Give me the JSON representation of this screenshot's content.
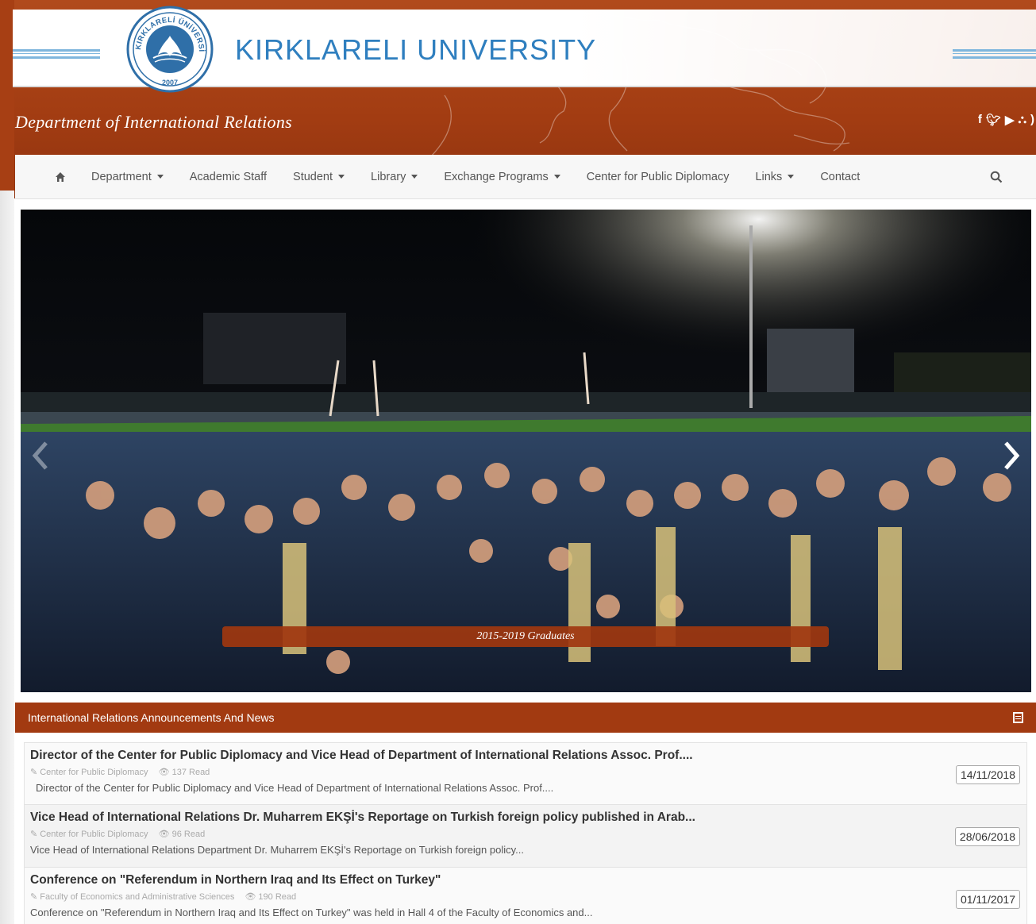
{
  "header": {
    "university_name": "KIRKLARELI UNIVERSITY",
    "department_title": "Department of International Relations",
    "seal": {
      "top_text": "KIRKLARELİ ÜNİVERSİTESİ",
      "year": "2007"
    },
    "social_icons": [
      "facebook-icon",
      "twitter-icon",
      "youtube-icon",
      "sitemap-icon",
      "rss-icon"
    ]
  },
  "nav": {
    "items": [
      {
        "label": "Department",
        "dropdown": true
      },
      {
        "label": "Academic Staff",
        "dropdown": false
      },
      {
        "label": "Student",
        "dropdown": true
      },
      {
        "label": "Library",
        "dropdown": true
      },
      {
        "label": "Exchange Programs",
        "dropdown": true
      },
      {
        "label": "Center for Public Diplomacy",
        "dropdown": false
      },
      {
        "label": "Links",
        "dropdown": true
      },
      {
        "label": "Contact",
        "dropdown": false
      }
    ]
  },
  "slider": {
    "caption": "2015-2019 Graduates"
  },
  "news": {
    "heading": "International Relations Announcements And News",
    "items": [
      {
        "title": "Director of the Center for Public Diplomacy and Vice Head of Department of International Relations Assoc. Prof....",
        "category": "Center for Public Diplomacy",
        "reads": "137 Read",
        "summary": "Director of the Center for Public Diplomacy and Vice Head of Department of International Relations Assoc. Prof....",
        "date": "14/11/2018"
      },
      {
        "title": "Vice Head of International Relations Dr. Muharrem EKŞİ's Reportage on Turkish foreign policy published in Arab...",
        "category": "Center for Public Diplomacy",
        "reads": "96 Read",
        "summary": "Vice Head of International Relations Department Dr. Muharrem EKŞİ's Reportage on Turkish foreign policy...",
        "date": "28/06/2018"
      },
      {
        "title": "Conference on \"Referendum in Northern Iraq and Its Effect on Turkey\"",
        "category": "Faculty of Economics and Administrative Sciences",
        "reads": "190 Read",
        "summary": "Conference on \"Referendum in Northern Iraq and Its Effect on Turkey\" was held in Hall 4 of the Faculty of Economics and...",
        "date": "01/11/2017"
      }
    ]
  },
  "colors": {
    "brand_brown": "#a23a11",
    "brand_blue": "#2f7fbf",
    "nav_bg": "#f7f7f7"
  }
}
